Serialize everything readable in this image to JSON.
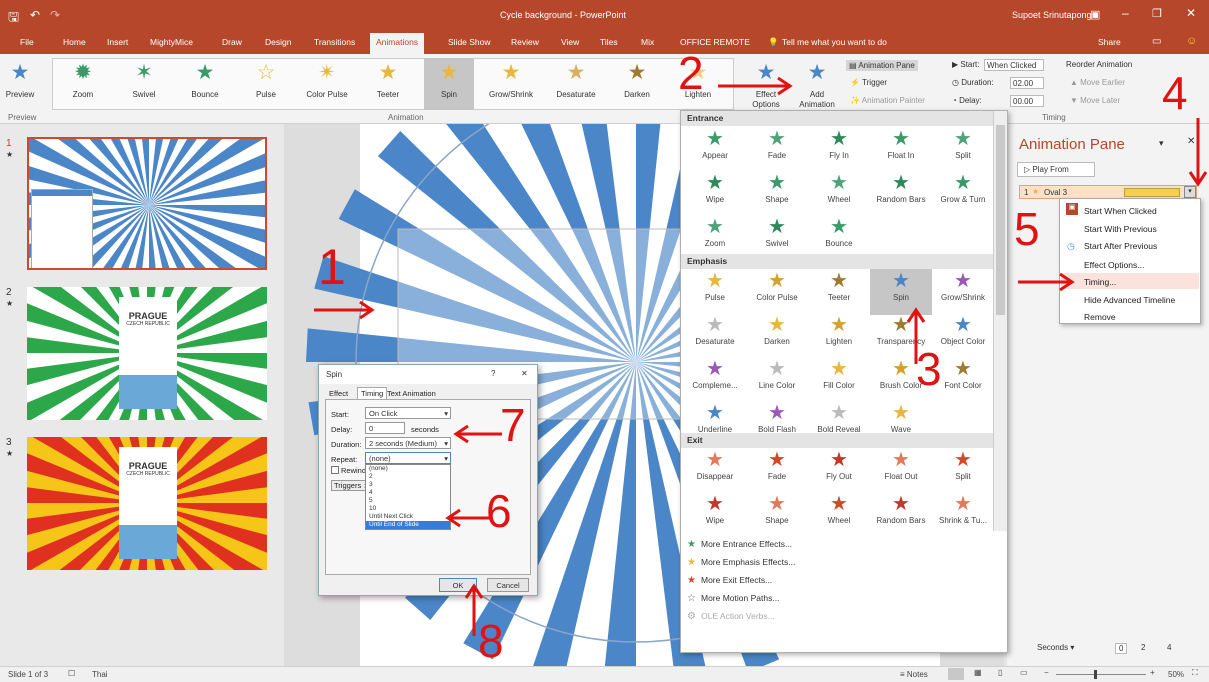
{
  "window": {
    "title": "Cycle background - PowerPoint",
    "user": "Supoet Srinutapong",
    "share": "Share"
  },
  "menu": [
    "File",
    "Home",
    "Insert",
    "MightyMice",
    "Draw",
    "Design",
    "Transitions",
    "Animations",
    "Slide Show",
    "Review",
    "View",
    "Tiles",
    "Mix",
    "OFFICE REMOTE"
  ],
  "tell_me": "Tell me what you want to do",
  "ribbon": {
    "preview": "Preview",
    "effects": [
      "Zoom",
      "Swivel",
      "Bounce",
      "Pulse",
      "Color Pulse",
      "Teeter",
      "Spin",
      "Grow/Shrink",
      "Desaturate",
      "Darken",
      "Lighten"
    ],
    "effect_options": "Effect Options",
    "add_animation": "Add Animation",
    "animation_pane": "Animation Pane",
    "trigger": "Trigger",
    "animation_painter": "Animation Painter",
    "start_label": "Start:",
    "start_value": "When Clicked",
    "duration_label": "Duration:",
    "duration_value": "02.00",
    "delay_label": "Delay:",
    "delay_value": "00.00",
    "reorder": "Reorder Animation",
    "move_earlier": "Move Earlier",
    "move_later": "Move Later",
    "group_preview": "Preview",
    "group_animation": "Animation",
    "group_timing": "Timing"
  },
  "slides": {
    "numbers": [
      "1",
      "2",
      "3"
    ],
    "title": "PRAGUE",
    "subtitle": "CZECH REPUBLIC"
  },
  "gallery": {
    "entrance_title": "Entrance",
    "entrance": [
      "Appear",
      "Fade",
      "Fly In",
      "Float In",
      "Split",
      "Wipe",
      "Shape",
      "Wheel",
      "Random Bars",
      "Grow & Turn",
      "Zoom",
      "Swivel",
      "Bounce"
    ],
    "emphasis_title": "Emphasis",
    "emphasis": [
      "Pulse",
      "Color Pulse",
      "Teeter",
      "Spin",
      "Grow/Shrink",
      "Desaturate",
      "Darken",
      "Lighten",
      "Transparency",
      "Object Color",
      "Compleme...",
      "Line Color",
      "Fill Color",
      "Brush Color",
      "Font Color",
      "Underline",
      "Bold Flash",
      "Bold Reveal",
      "Wave"
    ],
    "exit_title": "Exit",
    "exit": [
      "Disappear",
      "Fade",
      "Fly Out",
      "Float Out",
      "Split",
      "Wipe",
      "Shape",
      "Wheel",
      "Random Bars",
      "Shrink & Tu..."
    ],
    "more": [
      "More Entrance Effects...",
      "More Emphasis Effects...",
      "More Exit Effects...",
      "More Motion Paths...",
      "OLE Action Verbs..."
    ]
  },
  "anim_pane": {
    "title": "Animation Pane",
    "play_from": "Play From",
    "item_num": "1",
    "item_name": "Oval 3",
    "seconds": "Seconds",
    "ruler": [
      "0",
      "2",
      "4"
    ]
  },
  "context_menu": [
    "Start When Clicked",
    "Start With Previous",
    "Start After Previous",
    "Effect Options...",
    "Timing...",
    "Hide Advanced Timeline",
    "Remove"
  ],
  "dialog": {
    "title": "Spin",
    "tabs": [
      "Effect",
      "Timing",
      "Text Animation"
    ],
    "start_label": "Start:",
    "start_value": "On Click",
    "delay_label": "Delay:",
    "delay_value": "0",
    "delay_unit": "seconds",
    "duration_label": "Duration:",
    "duration_value": "2 seconds (Medium)",
    "repeat_label": "Repeat:",
    "repeat_value": "(none)",
    "rewind_label": "Rewind",
    "triggers_label": "Triggers",
    "repeat_options": [
      "(none)",
      "2",
      "3",
      "4",
      "5",
      "10",
      "Until Next Click",
      "Until End of Slide"
    ],
    "ok": "OK",
    "cancel": "Cancel"
  },
  "status": {
    "slide": "Slide 1 of 3",
    "language": "Thai",
    "notes": "Notes",
    "zoom": "50%"
  },
  "annotations": [
    "1",
    "2",
    "3",
    "4",
    "5",
    "6",
    "7",
    "8"
  ],
  "colors": {
    "accent": "#b7472a",
    "ray_blue": "#4a86c8",
    "annotation": "#e01212"
  }
}
